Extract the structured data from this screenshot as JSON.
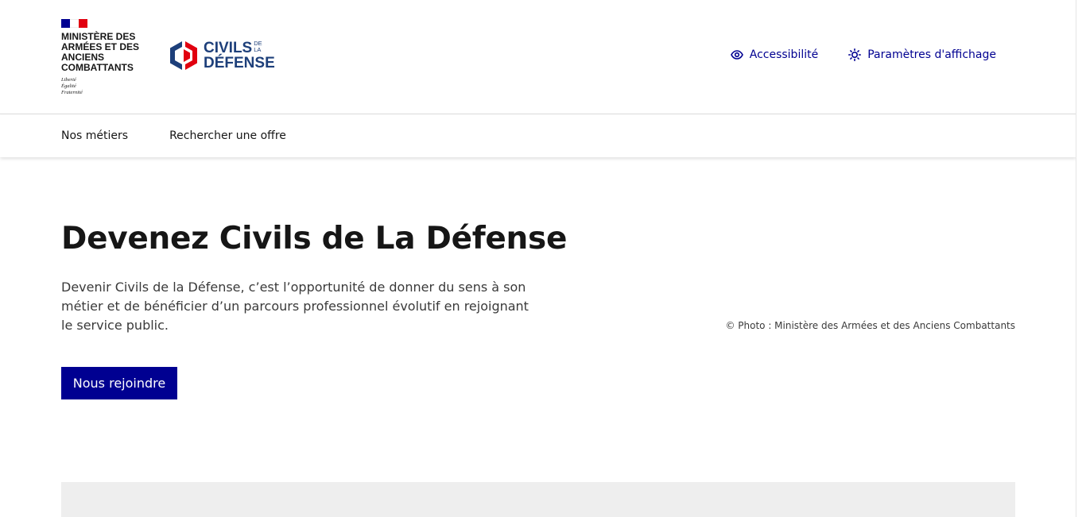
{
  "header": {
    "ministry_name": "Ministère des Armées et des Anciens Combattants",
    "motto": [
      "Liberté",
      "Égalité",
      "Fraternité"
    ],
    "operator": {
      "line1": "CIVILS",
      "small_top": "DE",
      "small_bottom": "LA",
      "line2": "DÉFENSE"
    },
    "tools": [
      {
        "label": "Accessibilité",
        "icon": "eye-icon"
      },
      {
        "label": "Paramètres d'affichage",
        "icon": "sun-icon"
      }
    ]
  },
  "nav": {
    "items": [
      {
        "label": "Nos métiers"
      },
      {
        "label": "Rechercher une offre"
      }
    ]
  },
  "hero": {
    "title": "Devenez Civils de La Défense",
    "text": "Devenir Civils de la Défense, c’est l’opportunité de donner du sens à son métier et de bénéficier d’un parcours professionnel évolutif en rejoignant le service public.",
    "cta_label": "Nous rejoindre",
    "photo_credit": "© Photo : Ministère des Armées et des Anciens Combattants"
  },
  "colors": {
    "primary": "#000091",
    "flag_blue": "#000091",
    "flag_red": "#e1000f",
    "logo_blue": "#1d3f7a",
    "logo_red": "#e1000f"
  }
}
